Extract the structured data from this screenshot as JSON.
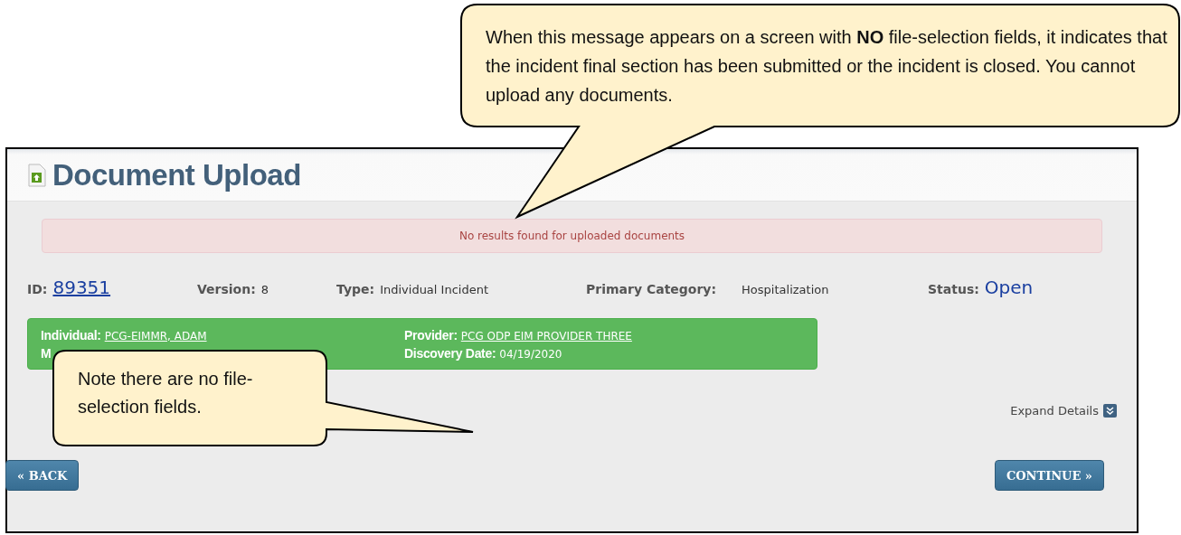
{
  "header": {
    "title": "Document Upload"
  },
  "alert": {
    "message": "No results found for uploaded documents"
  },
  "summary": [
    {
      "label": "ID:",
      "value": "89351",
      "kind": "link"
    },
    {
      "label": "Version:",
      "value": "8",
      "kind": "plain"
    },
    {
      "label": "Type:",
      "value": "Individual Incident",
      "kind": "plain"
    },
    {
      "label": "Primary Category:",
      "value": "Hospitalization",
      "kind": "plain"
    },
    {
      "label": "Status:",
      "value": "Open",
      "kind": "status"
    }
  ],
  "banner": {
    "fields": [
      {
        "label": "Individual:",
        "value": "PCG-EIMMR, ADAM",
        "kind": "link"
      },
      {
        "label": "Provider:",
        "value": "PCG ODP EIM PROVIDER THREE",
        "kind": "link"
      },
      {
        "label": "M",
        "kind": "label"
      },
      {
        "label": "Discovery Date:",
        "value": "04/19/2020",
        "kind": "plain"
      }
    ]
  },
  "expand_details": {
    "label": "Expand Details"
  },
  "buttons": [
    {
      "label": "« BACK"
    },
    {
      "label": "CONTINUE »"
    }
  ],
  "callouts": [
    {
      "text": "When this message appears on a screen with **NO** file-selection fields, it indicates that the incident final section has been submitted or the incident is closed. You cannot upload any documents."
    },
    {
      "text": "Note there are no file-selection fields."
    }
  ]
}
